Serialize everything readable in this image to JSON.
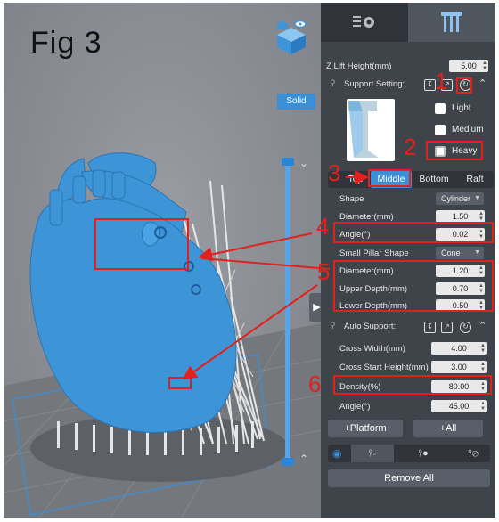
{
  "figure": {
    "label": "Fig 3"
  },
  "viewport": {
    "render_mode_label": "Solid",
    "colors": {
      "model": "#3d95d8",
      "supports": "#e0e0e0",
      "floor": "#6f7378"
    }
  },
  "panel": {
    "tabs": [
      {
        "icon": "settings-icon"
      },
      {
        "icon": "support-pillars-icon",
        "active": true
      }
    ],
    "z_lift": {
      "label": "Z Lift Height(mm)",
      "value": "5.00"
    },
    "support_setting": {
      "title": "Support Setting:",
      "densities": [
        {
          "label": "Light",
          "checked": false
        },
        {
          "label": "Medium",
          "checked": false
        },
        {
          "label": "Heavy",
          "checked": true
        }
      ],
      "tabs": [
        {
          "label": "Top",
          "active": false
        },
        {
          "label": "Middle",
          "active": true
        },
        {
          "label": "Bottom",
          "active": false
        },
        {
          "label": "Raft",
          "active": false
        }
      ],
      "shape": {
        "label": "Shape",
        "value": "Cylinder"
      },
      "diameter": {
        "label": "Diameter(mm)",
        "value": "1.50"
      },
      "angle": {
        "label": "Angle(°)",
        "value": "0.02"
      },
      "small_pillar_shape": {
        "label": "Small Pillar Shape",
        "value": "Cone"
      },
      "sp_diameter": {
        "label": "Diameter(mm)",
        "value": "1.20"
      },
      "upper_depth": {
        "label": "Upper Depth(mm)",
        "value": "0.70"
      },
      "lower_depth": {
        "label": "Lower Depth(mm)",
        "value": "0.50"
      }
    },
    "auto_support": {
      "title": "Auto Support:",
      "cross_width": {
        "label": "Cross Width(mm)",
        "value": "4.00"
      },
      "cross_start_height": {
        "label": "Cross Start Height(mm)",
        "value": "3.00"
      },
      "density": {
        "label": "Density(%)",
        "value": "80.00"
      },
      "angle": {
        "label": "Angle(°)",
        "value": "45.00"
      }
    },
    "buttons": {
      "platform": "+Platform",
      "all": "+All",
      "remove_all": "Remove All"
    }
  },
  "annotations": {
    "color": "#e3201b",
    "numbers": [
      "1",
      "2",
      "3",
      "4",
      "5",
      "6"
    ]
  }
}
